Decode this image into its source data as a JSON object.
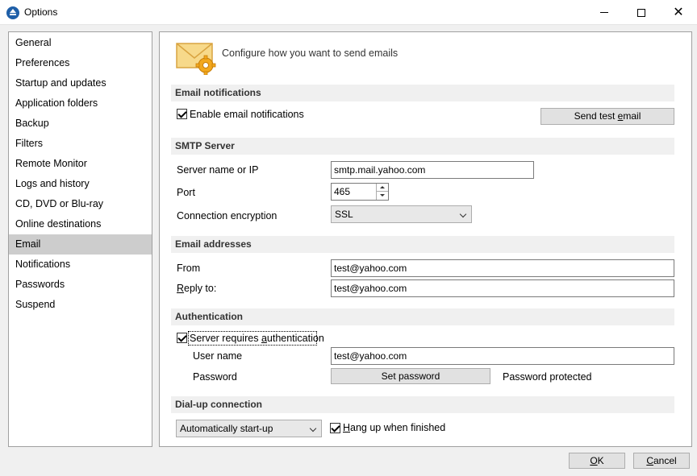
{
  "window": {
    "title": "Options"
  },
  "sidebar": {
    "items": [
      {
        "label": "General"
      },
      {
        "label": "Preferences"
      },
      {
        "label": "Startup and updates"
      },
      {
        "label": "Application folders"
      },
      {
        "label": "Backup"
      },
      {
        "label": "Filters"
      },
      {
        "label": "Remote Monitor"
      },
      {
        "label": "Logs and history"
      },
      {
        "label": "CD, DVD or Blu-ray"
      },
      {
        "label": "Online destinations"
      },
      {
        "label": "Email"
      },
      {
        "label": "Notifications"
      },
      {
        "label": "Passwords"
      },
      {
        "label": "Suspend"
      }
    ],
    "selected": "Email"
  },
  "header": {
    "text": "Configure how you want to send emails",
    "icon": "email-settings-icon"
  },
  "email_notifications": {
    "title": "Email notifications",
    "enable_label": "Enable email notifications",
    "enabled": true,
    "send_test_label_pre": "Send test ",
    "send_test_label_u": "e",
    "send_test_label_post": "mail"
  },
  "smtp": {
    "title": "SMTP Server",
    "server_label": "Server name or IP",
    "server_value": "smtp.mail.yahoo.com",
    "port_label": "Port",
    "port_value": "465",
    "encryption_label": "Connection encryption",
    "encryption_value": "SSL"
  },
  "addresses": {
    "title": "Email addresses",
    "from_label": "From",
    "from_value": "test@yahoo.com",
    "reply_label_u": "R",
    "reply_label_rest": "eply to:",
    "reply_value": "test@yahoo.com"
  },
  "auth": {
    "title": "Authentication",
    "requires_label_pre": "Server requires ",
    "requires_label_u": "a",
    "requires_label_post": "uthentication",
    "requires": true,
    "username_label": "User name",
    "username_value": "test@yahoo.com",
    "password_label": "Password",
    "set_password_label": "Set password",
    "password_status": "Password protected"
  },
  "dialup": {
    "title": "Dial-up connection",
    "mode_value": "Automatically start-up",
    "hangup_label_u": "H",
    "hangup_label_rest": "ang up when finished",
    "hangup": true
  },
  "footer": {
    "ok_u": "O",
    "ok_rest": "K",
    "cancel_u": "C",
    "cancel_rest": "ancel"
  }
}
